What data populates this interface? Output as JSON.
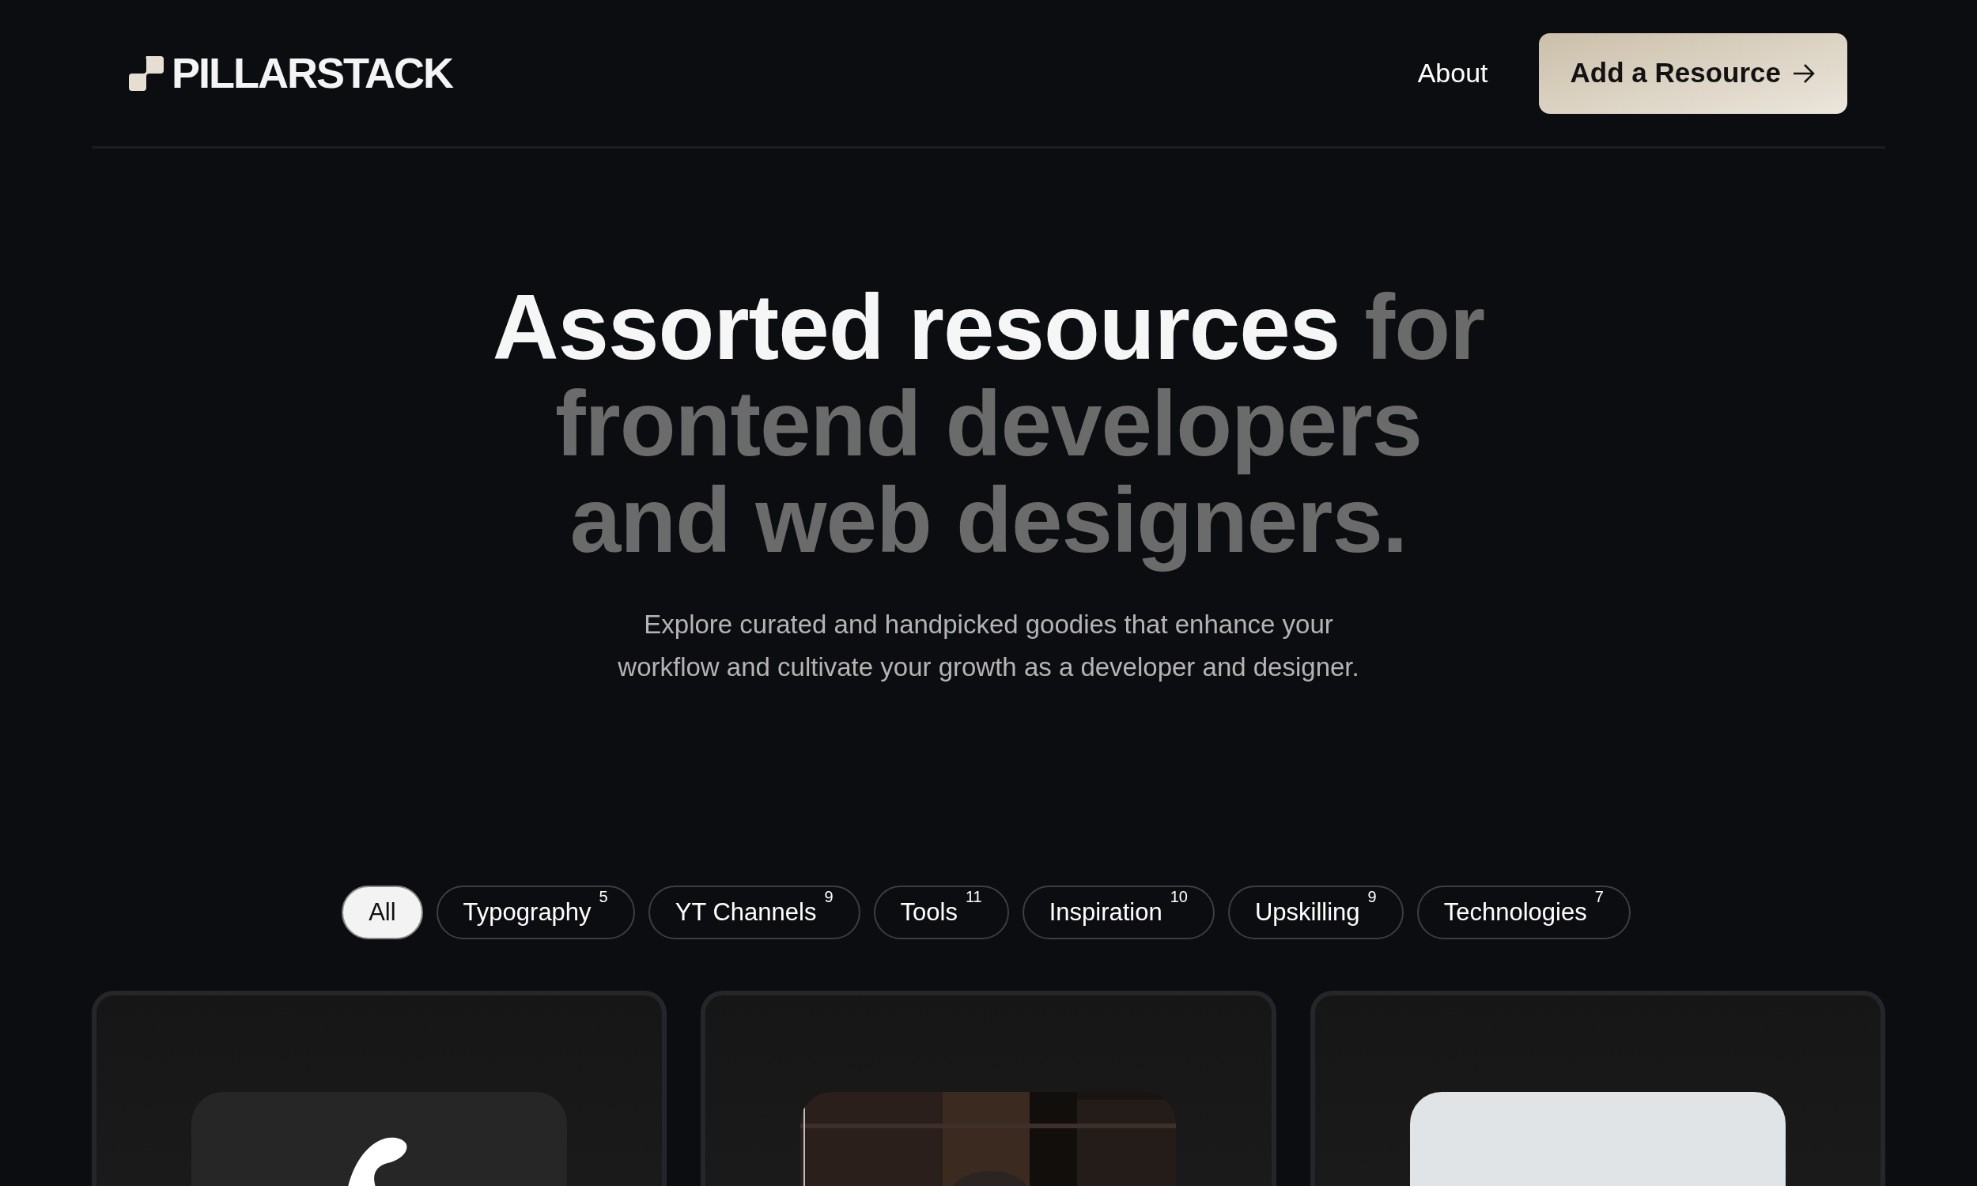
{
  "header": {
    "logo": "PILLARSTACK",
    "nav": [
      "About"
    ],
    "cta": "Add a Resource"
  },
  "hero": {
    "headline": {
      "highlight": "Assorted resources",
      "rest": "for frontend developers and web designers."
    },
    "lines": [
      "Explore curated and handpicked goodies that enhance your",
      "workflow and cultivate your growth as a developer and designer."
    ]
  },
  "filters": [
    {
      "label": "All",
      "selected": true
    },
    {
      "label": "Typography",
      "count": "5",
      "selected": false
    },
    {
      "label": "YT Channels",
      "count": "9",
      "selected": false
    },
    {
      "label": "Tools",
      "count": "11",
      "selected": false
    },
    {
      "label": "Inspiration",
      "count": "10",
      "selected": false
    },
    {
      "label": "Upskilling",
      "count": "9",
      "selected": false
    },
    {
      "label": "Technologies",
      "count": "7",
      "selected": false
    }
  ],
  "cards": [
    {
      "kind": "logo"
    },
    {
      "kind": "picture"
    },
    {
      "kind": "blank"
    }
  ]
}
